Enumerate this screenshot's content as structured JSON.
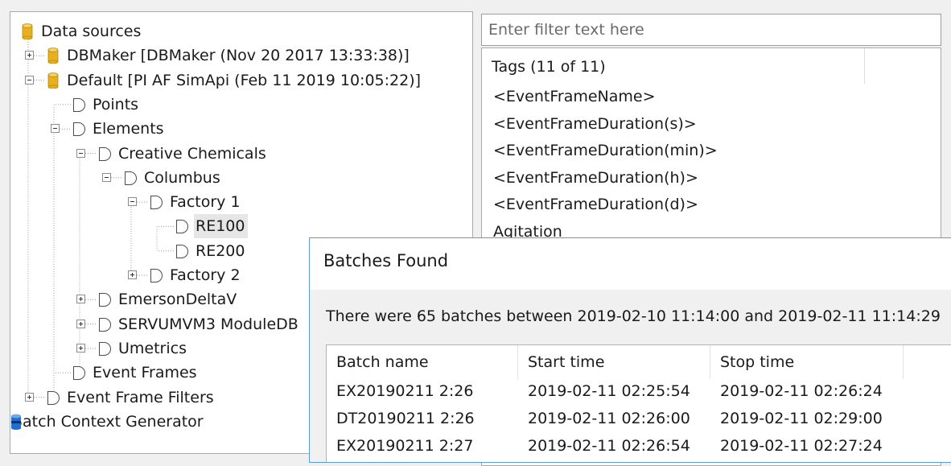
{
  "tree": {
    "root": {
      "label": "Data sources",
      "icon": "database-icon"
    },
    "nodes": [
      {
        "id": "dbmaker",
        "label": "DBMaker [DBMaker (Nov 20 2017 13:33:38)]",
        "icon": "database-icon",
        "expander": "plus"
      },
      {
        "id": "default",
        "label": "Default [PI AF SimApi (Feb 11 2019 10:05:22)]",
        "icon": "database-icon",
        "expander": "minus"
      },
      {
        "id": "points",
        "label": "Points",
        "icon": "element-icon",
        "expander": "none"
      },
      {
        "id": "elements",
        "label": "Elements",
        "icon": "element-icon",
        "expander": "minus"
      },
      {
        "id": "creative-chemicals",
        "label": "Creative Chemicals",
        "icon": "element-icon",
        "expander": "minus"
      },
      {
        "id": "columbus",
        "label": "Columbus",
        "icon": "element-icon",
        "expander": "minus"
      },
      {
        "id": "factory-1",
        "label": "Factory 1",
        "icon": "element-icon",
        "expander": "minus"
      },
      {
        "id": "re100",
        "label": "RE100",
        "icon": "element-icon",
        "expander": "none",
        "selected": true
      },
      {
        "id": "re200",
        "label": "RE200",
        "icon": "element-icon",
        "expander": "none"
      },
      {
        "id": "factory-2",
        "label": "Factory 2",
        "icon": "element-icon",
        "expander": "plus"
      },
      {
        "id": "emerson-deltav",
        "label": "EmersonDeltaV",
        "icon": "element-icon",
        "expander": "plus"
      },
      {
        "id": "servumvm3",
        "label": "SERVUMVM3 ModuleDB",
        "icon": "element-icon",
        "expander": "plus"
      },
      {
        "id": "umetrics",
        "label": "Umetrics",
        "icon": "element-icon",
        "expander": "plus"
      },
      {
        "id": "event-frames",
        "label": "Event Frames",
        "icon": "element-icon",
        "expander": "none"
      },
      {
        "id": "event-frame-filters",
        "label": "Event Frame Filters",
        "icon": "element-icon",
        "expander": "plus"
      },
      {
        "id": "batch-context-generator",
        "label": "Batch Context Generator",
        "icon": "batch-generator-icon",
        "expander": "none"
      }
    ]
  },
  "filter": {
    "placeholder": "Enter filter text here",
    "value": ""
  },
  "tags": {
    "header": "Tags (11 of 11)",
    "items": [
      "<EventFrameName>",
      "<EventFrameDuration(s)>",
      "<EventFrameDuration(min)>",
      "<EventFrameDuration(h)>",
      "<EventFrameDuration(d)>",
      "Agitation"
    ]
  },
  "dialog": {
    "title": "Batches Found",
    "message": "There were 65 batches between 2019-02-10 11:14:00 and 2019-02-11 11:14:29",
    "columns": [
      "Batch name",
      "Start time",
      "Stop time"
    ],
    "rows": [
      [
        "EX20190211 2:26",
        "2019-02-11 02:25:54",
        "2019-02-11 02:26:24"
      ],
      [
        "DT20190211 2:26",
        "2019-02-11 02:26:00",
        "2019-02-11 02:29:00"
      ],
      [
        "EX20190211 2:27",
        "2019-02-11 02:26:54",
        "2019-02-11 02:27:24"
      ]
    ]
  },
  "colors": {
    "db_gold": "#e8b020",
    "batch_blue": "#1e6fd0",
    "dialog_border": "#5b9bd5",
    "selection": "#e6e6e6"
  }
}
